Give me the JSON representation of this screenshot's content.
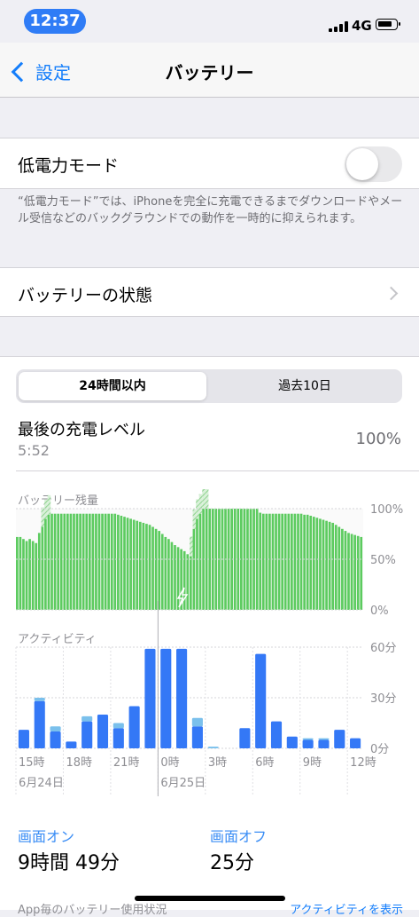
{
  "status_bar": {
    "time": "12:37",
    "network": "4G"
  },
  "nav": {
    "back_label": "設定",
    "title": "バッテリー"
  },
  "low_power": {
    "label": "低電力モード",
    "enabled": false,
    "footnote": "“低電力モード”では、iPhoneを完全に充電できるまでダウンロードやメール受信などのバックグラウンドでの動作を一時的に抑えられます。"
  },
  "battery_health": {
    "label": "バッテリーの状態"
  },
  "segment": {
    "selected": "24時間以内",
    "other": "過去10日"
  },
  "last_charge": {
    "title": "最後の充電レベル",
    "time": "5:52",
    "value": "100%"
  },
  "battery_level": {
    "title": "バッテリー残量",
    "y_labels": [
      "100%",
      "50%",
      "0%"
    ]
  },
  "activity": {
    "title": "アクティビティ",
    "y_labels": [
      "60分",
      "30分",
      "0分"
    ],
    "x_labels": [
      "15時",
      "18時",
      "21時",
      "0時",
      "3時",
      "6時",
      "9時",
      "12時"
    ],
    "date_labels": [
      "6月24日",
      "6月25日"
    ]
  },
  "chart_data": [
    {
      "type": "bar",
      "title": "バッテリー残量",
      "ylim": [
        0,
        100
      ],
      "unit": "%",
      "values": [
        72,
        72,
        70,
        68,
        70,
        68,
        66,
        76,
        82,
        90,
        94,
        95,
        95,
        95,
        95,
        95,
        95,
        95,
        95,
        95,
        95,
        95,
        95,
        95,
        95,
        95,
        95,
        95,
        95,
        95,
        95,
        95,
        94,
        93,
        92,
        91,
        90,
        89,
        88,
        87,
        86,
        85,
        84,
        82,
        80,
        78,
        75,
        72,
        70,
        67,
        64,
        62,
        60,
        58,
        55,
        53,
        80,
        90,
        95,
        100,
        100,
        100,
        100,
        100,
        100,
        100,
        100,
        100,
        100,
        100,
        100,
        100,
        100,
        100,
        100,
        100,
        100,
        96,
        95,
        95,
        95,
        95,
        95,
        95,
        95,
        95,
        95,
        95,
        95,
        95,
        95,
        94,
        94,
        93,
        92,
        91,
        90,
        89,
        88,
        87,
        86,
        84,
        82,
        80,
        78,
        76,
        75,
        74,
        73,
        72
      ],
      "charging": [
        [
          8,
          10
        ],
        [
          55,
          60
        ]
      ]
    },
    {
      "type": "bar",
      "title": "アクティビティ",
      "categories": [
        "14時",
        "15時",
        "16時",
        "17時",
        "18時",
        "19時",
        "20時",
        "21時",
        "22時",
        "23時",
        "0時",
        "1時",
        "2時",
        "3時",
        "4時",
        "5時",
        "6時",
        "7時",
        "8時",
        "9時",
        "10時",
        "11時"
      ],
      "ylim": [
        0,
        60
      ],
      "series": [
        {
          "name": "画面オン",
          "values": [
            11,
            28,
            10,
            4,
            16,
            20,
            12,
            25,
            59,
            59,
            59,
            13,
            0,
            0,
            12,
            56,
            16,
            7,
            5,
            5,
            11,
            6
          ]
        },
        {
          "name": "画面オフ",
          "values": [
            0,
            2,
            3,
            0,
            3,
            0,
            3,
            0,
            0,
            0,
            0,
            5,
            1,
            0,
            0,
            0,
            0,
            0,
            1,
            1,
            0,
            0
          ]
        }
      ]
    }
  ],
  "summary": {
    "screen_on_label": "画面オン",
    "screen_on_value": "9時間 49分",
    "screen_off_label": "画面オフ",
    "screen_off_value": "25分"
  },
  "bottom": {
    "left": "App毎のバッテリー使用状況",
    "right": "アクティビティを表示"
  },
  "colors": {
    "accent": "#147efb",
    "battery_green": "#5ccb5f",
    "activity_blue": "#3478f6",
    "activity_light": "#7ac0ec"
  }
}
